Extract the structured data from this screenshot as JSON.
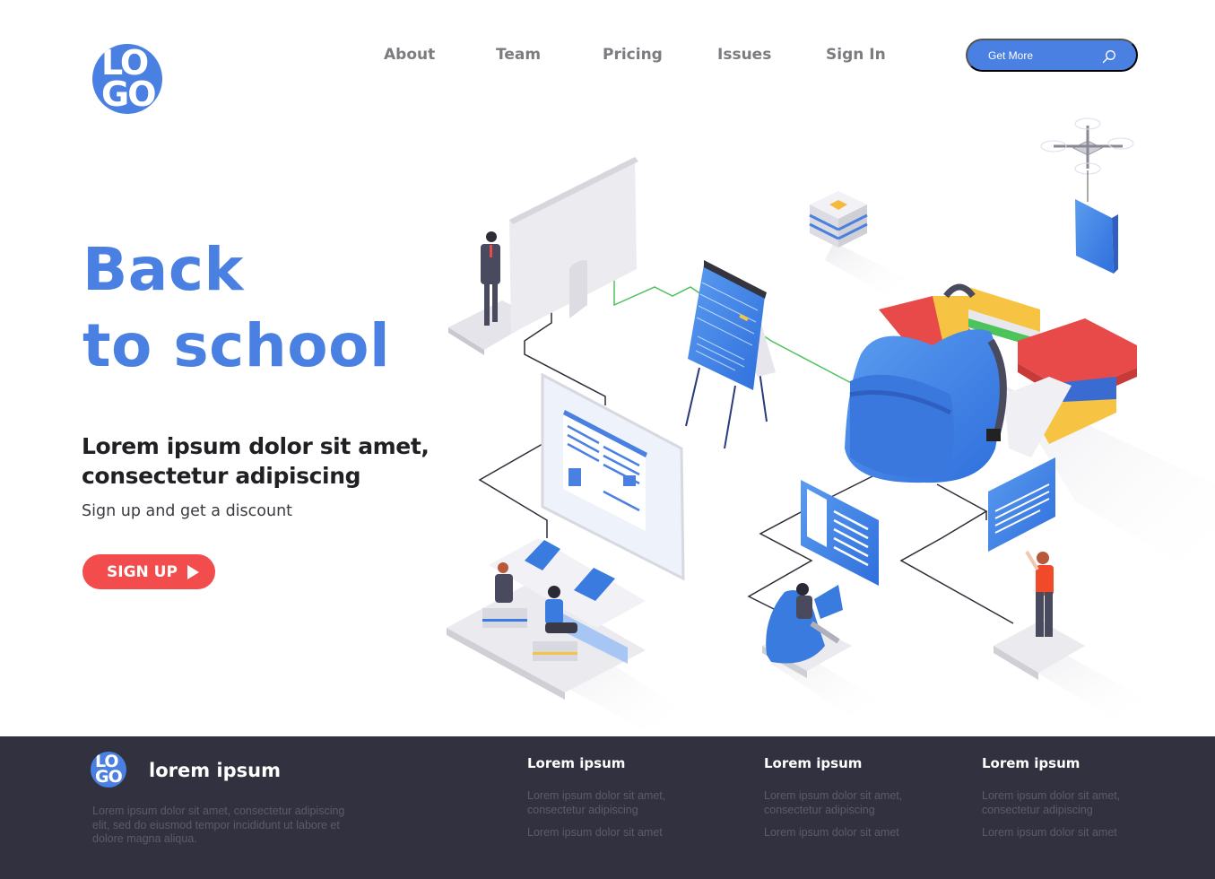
{
  "brand": {
    "logo_top": "LO",
    "logo_bottom": "GO",
    "accent_color": "#4a80e2",
    "cta_color": "#f24c4c",
    "footer_bg": "#32313f"
  },
  "nav": {
    "items": [
      {
        "label": "About"
      },
      {
        "label": "Team"
      },
      {
        "label": "Pricing"
      },
      {
        "label": "Issues"
      },
      {
        "label": "Sign In"
      }
    ],
    "get_more_label": "Get More",
    "get_more_icon": "search-icon"
  },
  "hero": {
    "title_line1": "Back",
    "title_line2": "to school",
    "subheading_line1": "Lorem ipsum dolor sit amet,",
    "subheading_line2": "consectetur adipiscing",
    "tagline": "Sign up and get a discount",
    "cta_label": "SIGN UP",
    "cta_icon": "play-icon"
  },
  "illustration": {
    "description": "Isometric back-to-school scene: teacher at large monitor, flip chart with schedule, backpack with books, drone carrying a book, students at laptops, student on bean bag, presenter pointing at screen"
  },
  "footer": {
    "logo_top": "LO",
    "logo_bottom": "GO",
    "brand_name": "lorem ipsum",
    "description": "Lorem ipsum dolor sit amet, consectetur adipiscing elit, sed do eiusmod tempor incididunt ut labore et dolore magna aliqua.",
    "columns": [
      {
        "title": "Lorem ipsum",
        "line1": "Lorem ipsum dolor sit amet, consectetur adipiscing",
        "line2": "Lorem ipsum dolor sit amet"
      },
      {
        "title": "Lorem ipsum",
        "line1": "Lorem ipsum dolor sit amet, consectetur adipiscing",
        "line2": "Lorem ipsum dolor sit amet"
      },
      {
        "title": "Lorem ipsum",
        "line1": "Lorem ipsum dolor sit amet, consectetur adipiscing",
        "line2": "Lorem ipsum dolor sit amet"
      }
    ]
  }
}
